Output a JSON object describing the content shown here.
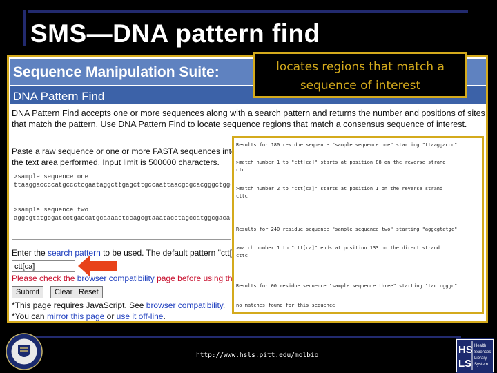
{
  "slide": {
    "title": "SMS—DNA pattern find",
    "url": "http://www.hsls.pitt.edu/molbio"
  },
  "callout": {
    "line1": "locates regions that match a",
    "line2": "sequence of interest"
  },
  "page": {
    "suite_title": "Sequence Manipulation Suite:",
    "tool_title": "DNA Pattern Find",
    "description": "DNA Pattern Find accepts one or more sequences along with a search pattern and returns the number and positions of sites that match the pattern. Use DNA Pattern Find to locate sequence regions that match a consensus sequence of interest.",
    "paste_text": "Paste a raw sequence or one or more FASTA sequences into the text area performed. Input limit is 500000 characters.",
    "sequence_textarea": ">sample sequence one\nttaaggaccccatgccctcgaataggcttgagcttgccaattaacgcgcacgggctggccgg\n\n\n>sample sequence two\naggcgtatgcgatcctgaccatgcaaaactccagcgtaaatacctagccatggcgacacaag",
    "enter_prefix": "Enter the ",
    "enter_link": "search pattern",
    "enter_suffix": " to be used. The default pattern \"ctt[ca]\" searches",
    "pattern_value": "ctt[ca]",
    "warn_prefix": "Please check the ",
    "warn_link": "browser compatibility",
    "warn_suffix": " page before using this program.",
    "buttons": {
      "submit": "Submit",
      "clear": "Clear",
      "reset": "Reset"
    },
    "js_prefix": "*This page requires JavaScript. See ",
    "js_link": "browser compatibility",
    "js_suffix": ".",
    "mirror_prefix": "*You can ",
    "mirror_link1": "mirror this page",
    "mirror_mid": " or ",
    "mirror_link2": "use it off-line",
    "mirror_suffix": "."
  },
  "results": [
    "Results for 180 residue sequence \"sample sequence one\" starting \"ttaaggaccc\"",
    ">match number 1 to \"ctt[ca]\" starts at position 88 on the reverse strand",
    "ctc",
    ">match number 2 to \"ctt[ca]\" starts at position 1 on the reverse strand",
    "cttc",
    "Results for 240 residue sequence \"sample sequence two\" starting \"aggcgtatgc\"",
    ">match number 1 to \"ctt[ca]\" ends at position 133 on the direct strand",
    "cttc",
    "Results for 00 residue sequence \"sample sequence three\" starting \"tactcgggc\"",
    "no matches found for this sequence"
  ],
  "colors": {
    "gold": "#d4aa1c",
    "header_light": "#5f82c0",
    "header_dark": "#3c62a8",
    "link": "#1f3fbf",
    "warning": "#c8102e",
    "arrow": "#e8421a"
  },
  "logos": {
    "seal": "university-seal",
    "hsls": [
      "HS",
      "LS",
      "Health",
      "Sciences",
      "Library",
      "System"
    ]
  }
}
